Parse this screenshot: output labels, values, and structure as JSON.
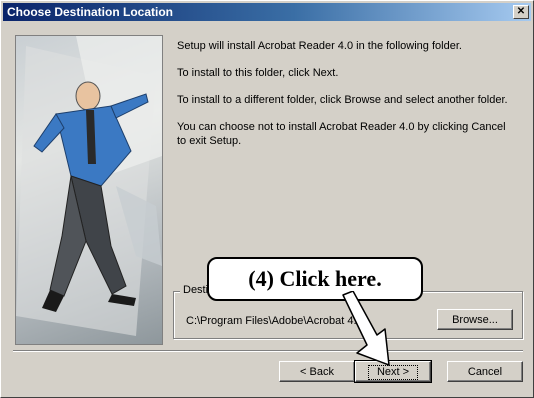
{
  "window": {
    "title": "Choose Destination Location",
    "close_glyph": "✕"
  },
  "body": {
    "paragraphs": [
      "Setup will install Acrobat Reader 4.0 in the following folder.",
      "To install to this folder, click Next.",
      "To install to a different folder, click Browse and select another folder.",
      "You can choose not to install Acrobat Reader 4.0 by clicking Cancel to exit Setup."
    ]
  },
  "destination": {
    "legend": "Destination Folder",
    "path": "C:\\Program Files\\Adobe\\Acrobat 4.0"
  },
  "buttons": {
    "browse": "Browse...",
    "back": "< Back",
    "next": "Next >",
    "cancel": "Cancel"
  },
  "annotation": {
    "callout_text": "(4)  Click here."
  },
  "icons": {
    "close": "close-icon",
    "arrow": "pointer-arrow-icon"
  }
}
